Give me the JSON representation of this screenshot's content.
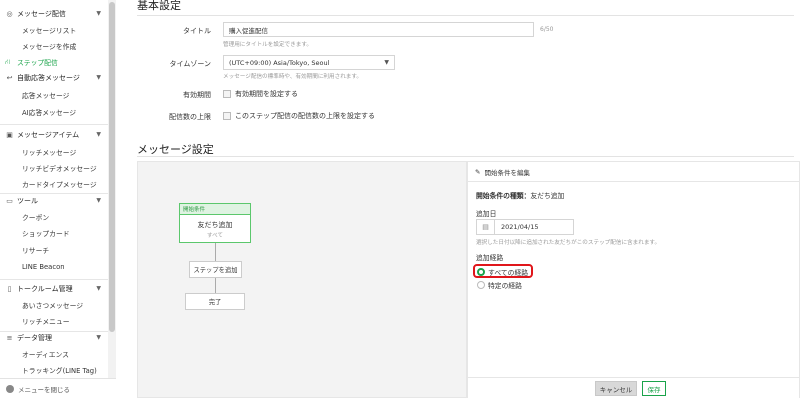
{
  "sidebar": {
    "groups": [
      {
        "label": "メッセージ配信",
        "icon": "broadcast-icon",
        "items": [
          "メッセージリスト",
          "メッセージを作成"
        ]
      },
      {
        "label": "ステップ配信",
        "icon": "step-icon",
        "active": true
      },
      {
        "label": "自動応答メッセージ",
        "icon": "auto-reply-icon",
        "items": [
          "応答メッセージ",
          "AI応答メッセージ"
        ]
      },
      {
        "label": "メッセージアイテム",
        "icon": "message-item-icon",
        "items": [
          "リッチメッセージ",
          "リッチビデオメッセージ",
          "カードタイプメッセージ"
        ]
      },
      {
        "label": "ツール",
        "icon": "folder-icon",
        "items": [
          "クーポン",
          "ショップカード",
          "リサーチ",
          "LINE Beacon"
        ]
      },
      {
        "label": "トークルーム管理",
        "icon": "talk-room-icon",
        "items": [
          "あいさつメッセージ",
          "リッチメニュー"
        ]
      },
      {
        "label": "データ管理",
        "icon": "database-icon",
        "items": [
          "オーディエンス",
          "トラッキング(LINE Tag)"
        ]
      }
    ],
    "footer_label": "メニューを閉じる"
  },
  "basic": {
    "heading": "基本設定",
    "title_label": "タイトル",
    "title_value": "購入促進配信",
    "title_counter": "6/50",
    "title_help": "管理用にタイトルを設定できます。",
    "timezone_label": "タイムゾーン",
    "timezone_value": "(UTC+09:00) Asia/Tokyo, Seoul",
    "timezone_help": "メッセージ配信の標準時や、有効期間に利用されます。",
    "period_label": "有効期間",
    "period_checkbox": "有効期間を設定する",
    "limit_label": "配信数の上限",
    "limit_checkbox": "このステップ配信の配信数の上限を設定する"
  },
  "message_settings": {
    "heading": "メッセージ設定",
    "start_node_header": "開始条件",
    "start_node_title": "友だち追加",
    "start_node_sub": "すべて",
    "add_step_label": "ステップを追加",
    "end_label": "完了"
  },
  "panel": {
    "header": "開始条件を編集",
    "type_label": "開始条件の種類：",
    "type_value": "友だち追加",
    "date_label": "追加日",
    "date_value": "2021/04/15",
    "date_help": "選択した日付以降に追加された友だちがこのステップ配信に含まれます。",
    "route_label": "追加経路",
    "route_options": [
      "すべての経路",
      "特定の経路"
    ],
    "selected_route": "すべての経路",
    "cancel_label": "キャンセル",
    "save_label": "保存"
  },
  "colors": {
    "accent": "#1aa34a",
    "highlight": "#e0161b"
  }
}
